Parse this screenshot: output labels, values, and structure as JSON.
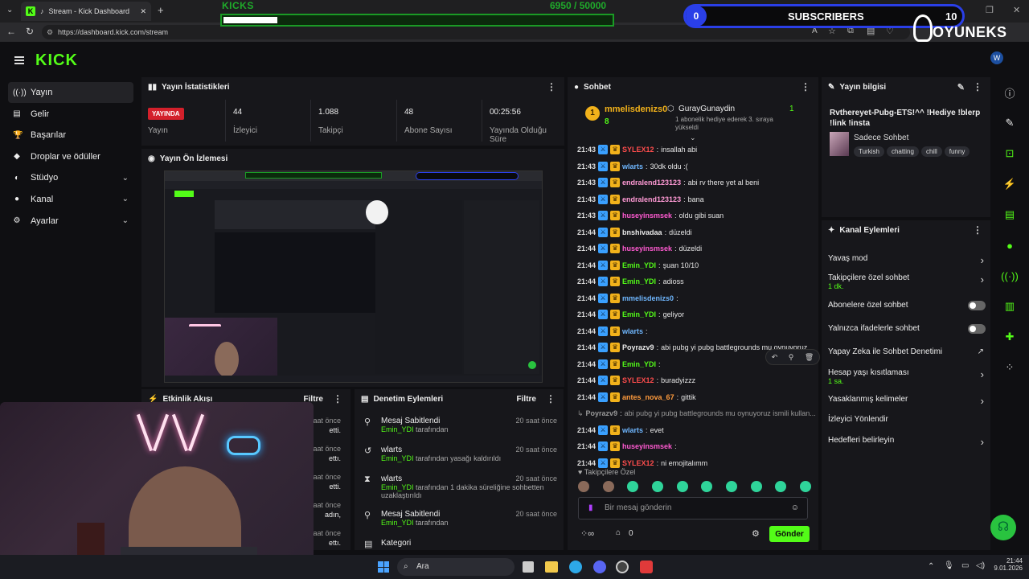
{
  "browser": {
    "tab_title": "Stream - Kick Dashboard",
    "url": "https://dashboard.kick.com/stream"
  },
  "overlay": {
    "kicks_label": "KICKS",
    "kicks_count": "6950 / 50000",
    "kicks_progress": 0.139,
    "subs_count": "0",
    "subs_label": "SUBSCRIBERS",
    "subs_goal": "10",
    "brand": "OYUNEKS"
  },
  "app": {
    "logo": "KICK",
    "sidebar": [
      {
        "icon": "broadcast-icon",
        "label": "Yayın",
        "active": true,
        "expand": false
      },
      {
        "icon": "revenue-icon",
        "label": "Gelir",
        "active": false,
        "expand": false
      },
      {
        "icon": "trophy-icon",
        "label": "Başarılar",
        "active": false,
        "expand": false
      },
      {
        "icon": "gift-icon",
        "label": "Droplar ve ödüller",
        "active": false,
        "expand": false
      },
      {
        "icon": "studio-icon",
        "label": "Stüdyo",
        "active": false,
        "expand": true
      },
      {
        "icon": "channel-icon",
        "label": "Kanal",
        "active": false,
        "expand": true
      },
      {
        "icon": "settings-icon",
        "label": "Ayarlar",
        "active": false,
        "expand": true
      }
    ]
  },
  "stats": {
    "title": "Yayın İstatistikleri",
    "live_badge": "YAYINDA",
    "live_label": "Yayın",
    "viewers_value": "44",
    "viewers_label": "İzleyici",
    "followers_value": "1.088",
    "followers_label": "Takipçi",
    "subs_value": "48",
    "subs_label": "Abone Sayısı",
    "uptime_value": "00:25:56",
    "uptime_label": "Yayında Olduğu Süre"
  },
  "preview": {
    "title": "Yayın Ön İzlemesi"
  },
  "activity": {
    "title": "Etkinlik Akışı",
    "filter": "Filtre",
    "items": [
      {
        "ago": "saat önce",
        "text": "etti."
      },
      {
        "ago": "saat önce",
        "text": "ettı."
      },
      {
        "ago": "saat önce",
        "text": "etti."
      },
      {
        "ago": "saat önce",
        "text": "adın,"
      },
      {
        "ago": "saat önce",
        "text": "ettı."
      }
    ]
  },
  "moderation": {
    "title": "Denetim Eylemleri",
    "filter": "Filtre",
    "items": [
      {
        "icon": "pin-icon",
        "title": "Mesaj Sabitlendi",
        "user": "Emin_YDI",
        "desc": "tarafından",
        "ago": "20 saat önce"
      },
      {
        "icon": "unban-icon",
        "title": "wlarts",
        "user": "Emin_YDI",
        "desc": "tarafından yasağı kaldırıldı",
        "ago": "20 saat önce"
      },
      {
        "icon": "timeout-icon",
        "title": "wlarts",
        "user": "Emin_YDI",
        "desc": "tarafından 1 dakika süreliğine sohbetten uzaklaştırıldı",
        "ago": "20 saat önce"
      },
      {
        "icon": "pin-icon",
        "title": "Mesaj Sabitlendi",
        "user": "Emin_YDI",
        "desc": "tarafından",
        "ago": "20 saat önce"
      },
      {
        "icon": "category-icon",
        "title": "Kategori",
        "user": "",
        "desc": "",
        "ago": ""
      }
    ]
  },
  "chat": {
    "title": "Sohbet",
    "pinned_user": "mmelisdenizs0",
    "pinned_count": "8",
    "gift_user": "GurayGunaydin",
    "gift_count": "1",
    "gift_text": "1 abonelik hediye ederek 3. sıraya yükseldi",
    "messages": [
      {
        "time": "21:43",
        "user": "SYLEX12",
        "color": "#ff4d4d",
        "text": "insallah abi"
      },
      {
        "time": "21:43",
        "user": "wlarts",
        "color": "#6fb7ff",
        "text": "30dk oldu :("
      },
      {
        "time": "21:43",
        "user": "endralend123123",
        "color": "#ff9ad5",
        "text": "abi rv there yet al beni"
      },
      {
        "time": "21:43",
        "user": "endralend123123",
        "color": "#ff9ad5",
        "text": "bana"
      },
      {
        "time": "21:43",
        "user": "huseyinsmsek",
        "color": "#ff5ad1",
        "text": "oldu gibi suan"
      },
      {
        "time": "21:44",
        "user": "bnshivadaa",
        "color": "#eaeaea",
        "text": "düzeldi"
      },
      {
        "time": "21:44",
        "user": "huseyinsmsek",
        "color": "#ff5ad1",
        "text": "düzeldi"
      },
      {
        "time": "21:44",
        "user": "Emin_YDI",
        "color": "#53fc18",
        "text": "şuan 10/10"
      },
      {
        "time": "21:44",
        "user": "Emin_YDI",
        "color": "#53fc18",
        "text": "adioss"
      },
      {
        "time": "21:44",
        "user": "mmelisdenizs0",
        "color": "#6fb7ff",
        "text": ""
      },
      {
        "time": "21:44",
        "user": "Emin_YDI",
        "color": "#53fc18",
        "text": "geliyor"
      },
      {
        "time": "21:44",
        "user": "wlarts",
        "color": "#6fb7ff",
        "text": ""
      },
      {
        "time": "21:44",
        "user": "Poyrazv9",
        "color": "#eaeaea",
        "text": "abi pubg yi pubg battlegrounds mu oynuyoruz"
      },
      {
        "time": "21:44",
        "user": "Emin_YDI",
        "color": "#53fc18",
        "text": ""
      },
      {
        "time": "21:44",
        "user": "SYLEX12",
        "color": "#ff4d4d",
        "text": "buradyizzz"
      },
      {
        "time": "21:44",
        "user": "antes_nova_67",
        "color": "#ff9b3d",
        "text": "gittik"
      },
      {
        "time": "",
        "user": "Poyrazv9",
        "color": "#999999",
        "text": "abi pubg yi pubg battlegrounds mu oynuyoruz ismili kullan..."
      },
      {
        "time": "21:44",
        "user": "wlarts",
        "color": "#6fb7ff",
        "text": "evet"
      },
      {
        "time": "21:44",
        "user": "huseyinsmsek",
        "color": "#ff5ad1",
        "text": ""
      },
      {
        "time": "21:44",
        "user": "SYLEX12",
        "color": "#ff4d4d",
        "text": "ni emojitalımm"
      }
    ],
    "followers_only": "Takipçilere Özel",
    "input_placeholder": "Bir mesaj gönderin",
    "points": "0",
    "send": "Gönder"
  },
  "stream_info": {
    "title": "Yayın bilgisi",
    "stream_title": "Rvthereyet-Pubg-ETS!^^ !Hediye !blerp !link !insta",
    "category": "Sadece Sohbet",
    "tags": [
      "Turkish",
      "chatting",
      "chill",
      "funny"
    ]
  },
  "channel_actions": {
    "title": "Kanal Eylemleri",
    "items": [
      {
        "label": "Yavaş mod",
        "sub": "",
        "control": "chevron"
      },
      {
        "label": "Takipçilere özel sohbet",
        "sub": "1 dk.",
        "control": "chevron"
      },
      {
        "label": "Abonelere özel sohbet",
        "sub": "",
        "control": "toggle"
      },
      {
        "label": "Yalnızca ifadelerle sohbet",
        "sub": "",
        "control": "toggle"
      },
      {
        "label": "Yapay Zeka ile Sohbet Denetimi",
        "sub": "",
        "control": "external"
      },
      {
        "label": "Hesap yaşı kısıtlaması",
        "sub": "1 sa.",
        "control": "chevron"
      },
      {
        "label": "Yasaklanmış kelimeler",
        "sub": "",
        "control": "chevron"
      },
      {
        "label": "İzleyici Yönlendir",
        "sub": "",
        "control": "none"
      },
      {
        "label": "Hedefleri belirleyin",
        "sub": "",
        "control": "chevron"
      }
    ]
  },
  "taskbar": {
    "search": "Ara",
    "time": "21:44",
    "date": "9.01.2026"
  },
  "colors": {
    "accent": "#53fc18",
    "live": "#d3202b",
    "subs_blue": "#2a3fe8"
  }
}
